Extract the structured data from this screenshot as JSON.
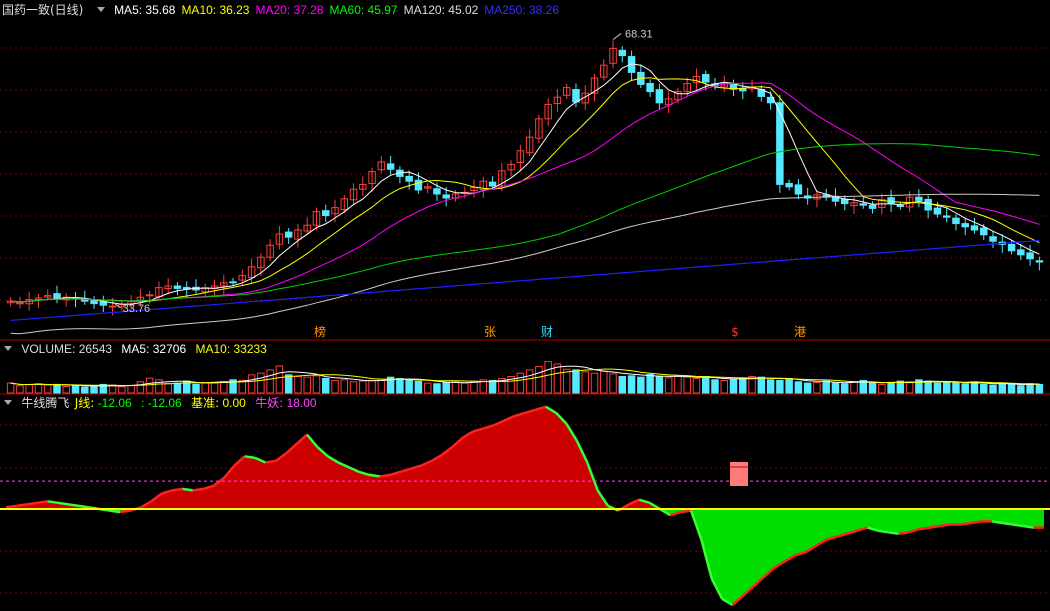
{
  "main": {
    "title": "国药一致(日线)",
    "ma": [
      {
        "label": "MA5: 35.68",
        "color": "#ffffff"
      },
      {
        "label": "MA10: 36.23",
        "color": "#ffff00"
      },
      {
        "label": "MA20: 37.28",
        "color": "#ff00ff"
      },
      {
        "label": "MA60: 45.97",
        "color": "#00ff00"
      },
      {
        "label": "MA120: 45.02",
        "color": "#dddddd"
      },
      {
        "label": "MA250: 38.26",
        "color": "#3030ff"
      }
    ],
    "high_label": "68.31",
    "low_label": "33.76",
    "markers": [
      {
        "text": "榜",
        "color": "#ff9900"
      },
      {
        "text": "张",
        "color": "#ff9900"
      },
      {
        "text": "财",
        "color": "#33ddff"
      },
      {
        "text": "$",
        "color": "#ff3333"
      },
      {
        "text": "港",
        "color": "#ff9900"
      }
    ]
  },
  "volume": {
    "label": "VOLUME: 26543",
    "ma5": "MA5: 32706",
    "ma10": "MA10: 33233"
  },
  "indicator": {
    "title": "牛线腾飞",
    "jline_label": "J线:",
    "jline_value": "-12.06",
    "sep": ":",
    "second_value": "-12.06",
    "base_label": "基准:",
    "base_value": "0.00",
    "niuyao_label": "牛妖:",
    "niuyao_value": "18.00"
  },
  "chart_data": {
    "type": "line",
    "candles": {
      "title": "国药一致(日线)",
      "y_high": 68.31,
      "y_low": 33.76,
      "close": [
        34.6,
        34.4,
        34.8,
        35.0,
        35.3,
        35.0,
        35.1,
        34.9,
        34.6,
        34.3,
        34.1,
        34.0,
        34.2,
        34.6,
        35.1,
        35.4,
        36.3,
        36.5,
        36.2,
        36.1,
        36.0,
        36.3,
        36.5,
        36.9,
        37.0,
        37.8,
        38.9,
        40.1,
        41.6,
        43.0,
        42.6,
        43.5,
        44.1,
        45.8,
        45.3,
        46.3,
        47.4,
        48.6,
        49.2,
        50.8,
        52.0,
        51.1,
        50.2,
        49.6,
        48.5,
        48.9,
        48.0,
        47.5,
        48.0,
        48.2,
        48.8,
        49.6,
        49.0,
        50.9,
        51.7,
        53.4,
        55.1,
        57.4,
        59.2,
        60.1,
        61.3,
        59.5,
        60.6,
        62.5,
        64.1,
        66.2,
        65.3,
        63.2,
        61.7,
        60.8,
        59.4,
        59.9,
        60.8,
        61.8,
        62.7,
        62.0,
        61.5,
        61.8,
        61.1,
        60.9,
        61.3,
        60.2,
        59.4,
        49.2,
        48.9,
        48.0,
        47.5,
        47.9,
        47.6,
        47.1,
        46.8,
        46.9,
        46.6,
        46.2,
        47.3,
        46.8,
        46.5,
        47.6,
        47.2,
        46.0,
        45.5,
        45.1,
        44.3,
        43.9,
        43.5,
        42.9,
        42.1,
        41.7,
        40.9,
        40.4,
        39.9,
        39.5
      ],
      "ma5_final": 35.68,
      "ma10_final": 36.23,
      "ma20_final": 37.28,
      "ma60_final": 45.97,
      "ma120_final": 45.02,
      "ma250_final": 38.26
    },
    "volume": {
      "last": 26543,
      "ma5": 32706,
      "ma10": 33233,
      "values": [
        30,
        22,
        25,
        28,
        24,
        26,
        20,
        22,
        18,
        21,
        26,
        24,
        19,
        23,
        34,
        45,
        40,
        28,
        30,
        36,
        26,
        32,
        30,
        35,
        40,
        38,
        55,
        60,
        70,
        82,
        55,
        50,
        48,
        52,
        44,
        38,
        40,
        34,
        36,
        38,
        42,
        48,
        44,
        40,
        35,
        30,
        28,
        32,
        34,
        30,
        36,
        40,
        38,
        44,
        50,
        60,
        70,
        80,
        95,
        88,
        72,
        70,
        64,
        60,
        66,
        58,
        50,
        52,
        48,
        56,
        50,
        46,
        52,
        48,
        44,
        50,
        40,
        38,
        42,
        46,
        50,
        48,
        40,
        38,
        44,
        34,
        30,
        32,
        36,
        30,
        28,
        34,
        38,
        30,
        26,
        32,
        36,
        34,
        40,
        36,
        30,
        34,
        30,
        28,
        34,
        26,
        24,
        30,
        26,
        22,
        28,
        26
      ]
    },
    "indicator": {
      "title": "牛线腾飞",
      "jline": -12.06,
      "base": 0.0,
      "niuyao": 18.0,
      "values": [
        1,
        2,
        3,
        4,
        5,
        4,
        3,
        2,
        1,
        0,
        -1,
        -2,
        -1,
        1,
        5,
        10,
        12,
        13,
        12,
        13,
        15,
        20,
        28,
        34,
        33,
        30,
        31,
        36,
        42,
        48,
        40,
        34,
        30,
        27,
        24,
        22,
        21,
        22,
        24,
        26,
        28,
        31,
        35,
        40,
        46,
        50,
        52,
        54,
        57,
        60,
        62,
        64,
        66,
        62,
        55,
        44,
        30,
        12,
        2,
        -1,
        3,
        6,
        4,
        0,
        -4,
        -2,
        -1,
        -20,
        -45,
        -58,
        -62,
        -56,
        -50,
        -44,
        -38,
        -34,
        -30,
        -28,
        -24,
        -20,
        -18,
        -16,
        -14,
        -12,
        -14,
        -15,
        -16,
        -15,
        -13,
        -12,
        -11,
        -10,
        -10,
        -9,
        -8,
        -8,
        -9,
        -10,
        -11,
        -12,
        -12
      ]
    }
  }
}
